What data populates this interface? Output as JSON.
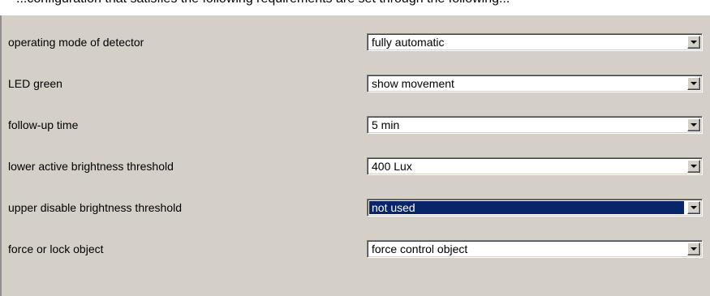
{
  "caption": "...configuration that satisfies the following requirements are set through the following...",
  "parameters": [
    {
      "label": "operating mode of detector",
      "value": "fully automatic",
      "selected": false
    },
    {
      "label": "LED green",
      "value": "show movement",
      "selected": false
    },
    {
      "label": "follow-up time",
      "value": "5 min",
      "selected": false
    },
    {
      "label": "lower active brightness threshold",
      "value": "400 Lux",
      "selected": false
    },
    {
      "label": "upper disable brightness threshold",
      "value": "not used",
      "selected": true
    },
    {
      "label": "force or lock object",
      "value": "force control object",
      "selected": false
    }
  ],
  "colors": {
    "panel": "#d4d0c8",
    "selection": "#0a246a",
    "field": "#ffffff"
  },
  "icons": {
    "dropdown": "chevron-down-icon"
  }
}
